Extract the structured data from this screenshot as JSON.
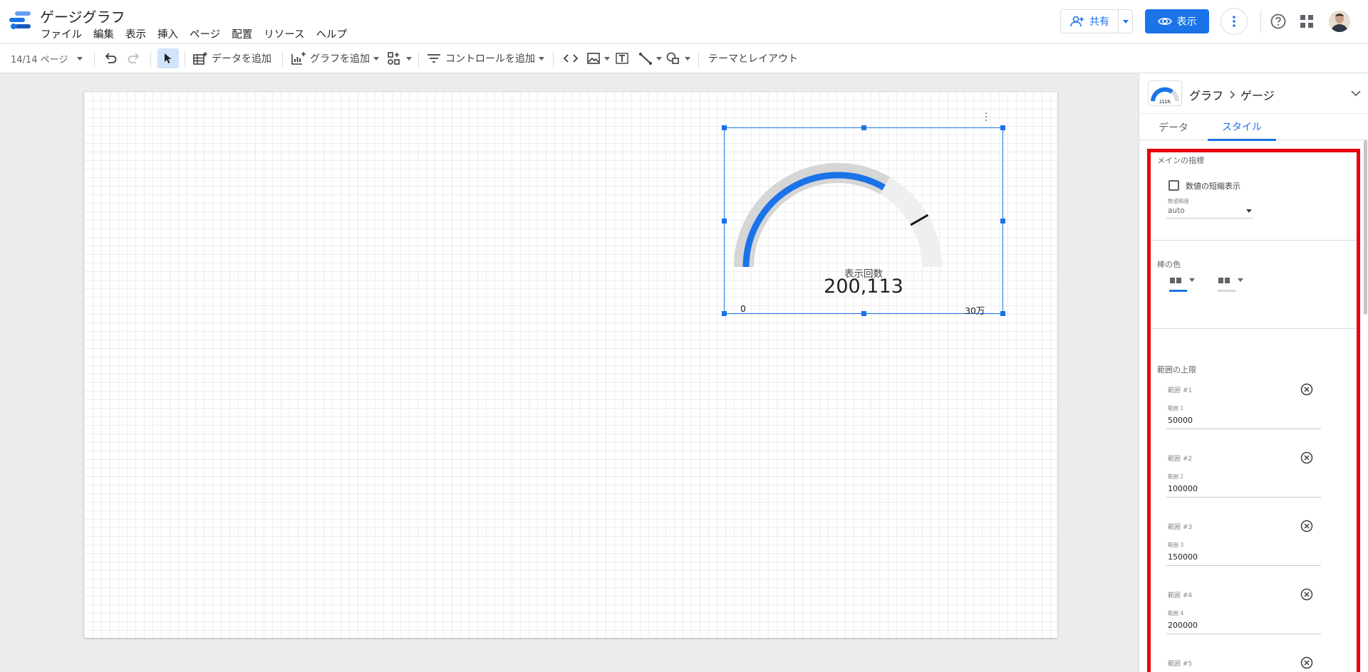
{
  "header": {
    "title": "ゲージグラフ",
    "menu": [
      "ファイル",
      "編集",
      "表示",
      "挿入",
      "ページ",
      "配置",
      "リソース",
      "ヘルプ"
    ],
    "share_label": "共有",
    "view_label": "表示"
  },
  "toolbar": {
    "page_indicator": "14/14 ページ",
    "add_data_label": "データを追加",
    "add_chart_label": "グラフを追加",
    "add_control_label": "コントロールを追加",
    "theme_layout_label": "テーマとレイアウト"
  },
  "chart": {
    "type": "gauge",
    "metric_label": "表示回数",
    "value_text": "200,113",
    "value": 200113,
    "min_label": "0",
    "max_label": "30万",
    "min": 0,
    "max": 300000,
    "target": 250000,
    "bar_color": "#1a73e8",
    "track_color": "#d6d6d6",
    "outer_color": "#efefef",
    "target_color": "#111111"
  },
  "panel": {
    "breadcrumb_parent": "グラフ",
    "breadcrumb_child": "ゲージ",
    "thumb_label": "111K",
    "tab_data": "データ",
    "tab_style": "スタイル",
    "main_metric": {
      "title": "メインの指標",
      "compact_numbers_label": "数値の短縮表示",
      "precision_label": "数値精度",
      "precision_value": "auto"
    },
    "bar_color": {
      "title": "棒の色",
      "swatch_1": "#1a73e8",
      "swatch_2": "#d6d6d6"
    },
    "range_max": {
      "title": "範囲の上限",
      "ranges": [
        {
          "header": "範囲 #1",
          "label": "範囲 1",
          "value": "50000"
        },
        {
          "header": "範囲 #2",
          "label": "範囲 2",
          "value": "100000"
        },
        {
          "header": "範囲 #3",
          "label": "範囲 3",
          "value": "150000"
        },
        {
          "header": "範囲 #4",
          "label": "範囲 4",
          "value": "200000"
        },
        {
          "header": "範囲 #5"
        }
      ]
    },
    "highlight_color": "#e8000b"
  }
}
